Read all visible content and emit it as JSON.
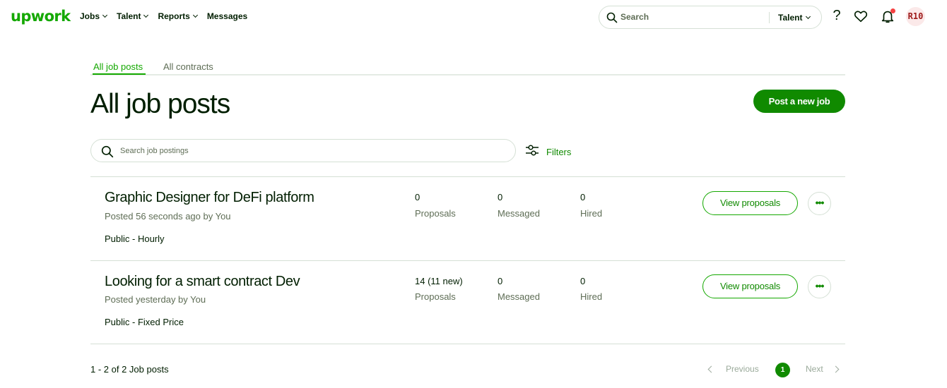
{
  "nav": {
    "logo": "upwork",
    "items": [
      "Jobs",
      "Talent",
      "Reports",
      "Messages"
    ],
    "search_placeholder": "Search",
    "search_scope": "Talent",
    "help_glyph": "?",
    "avatar_initials": "R10"
  },
  "tabs": [
    {
      "label": "All job posts",
      "active": true
    },
    {
      "label": "All contracts",
      "active": false
    }
  ],
  "page_title": "All job posts",
  "post_button": "Post a new job",
  "job_search_placeholder": "Search job postings",
  "filters_label": "Filters",
  "jobs": [
    {
      "title": "Graphic Designer for DeFi platform",
      "posted": "Posted 56 seconds ago by You",
      "type": "Public - Hourly",
      "proposals_value": "0",
      "proposals_label": "Proposals",
      "messaged_value": "0",
      "messaged_label": "Messaged",
      "hired_value": "0",
      "hired_label": "Hired",
      "view_button": "View proposals",
      "more_glyph": "•••"
    },
    {
      "title": "Looking for a smart contract Dev",
      "posted": "Posted yesterday by You",
      "type": "Public - Fixed Price",
      "proposals_value": "14 (11 new)",
      "proposals_label": "Proposals",
      "messaged_value": "0",
      "messaged_label": "Messaged",
      "hired_value": "0",
      "hired_label": "Hired",
      "view_button": "View proposals",
      "more_glyph": "•••"
    }
  ],
  "footer": {
    "count_text": "1 - 2 of 2 Job posts",
    "prev": "Previous",
    "page": "1",
    "next": "Next"
  },
  "colors": {
    "brand": "#14a800",
    "button": "#108a00",
    "text": "#001e00",
    "muted": "#5e6d55",
    "border": "#d5e0d5",
    "notification": "#f54242"
  }
}
